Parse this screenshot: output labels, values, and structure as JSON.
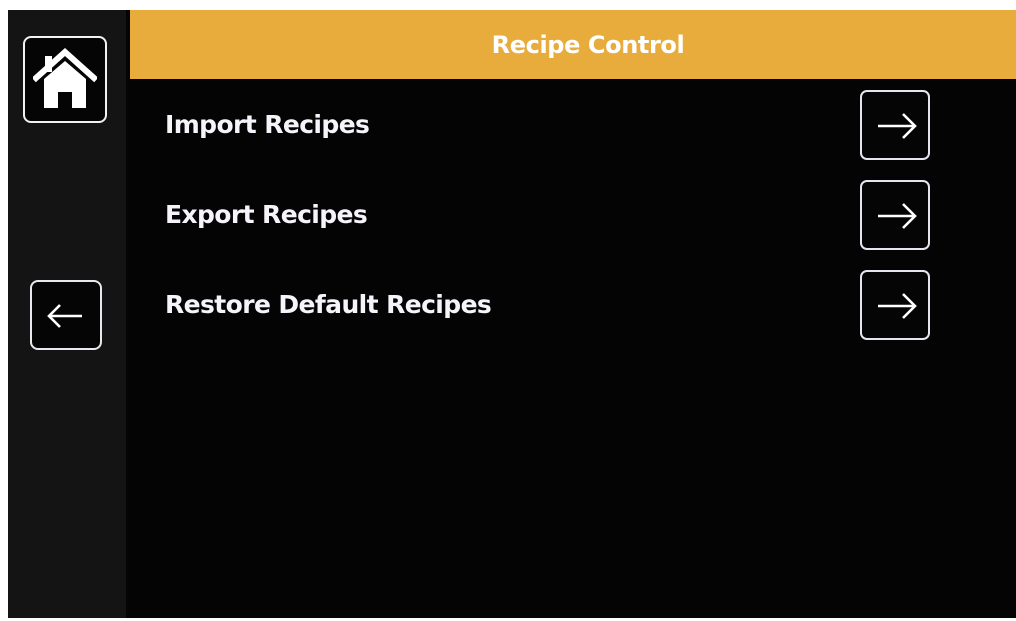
{
  "header": {
    "title": "Recipe Control",
    "accent_color": "#e7ac3c"
  },
  "sidebar": {
    "home_icon": "home-icon",
    "back_icon": "arrow-left-icon"
  },
  "menu": {
    "items": [
      {
        "label": "Import Recipes",
        "icon": "arrow-right-icon"
      },
      {
        "label": "Export Recipes",
        "icon": "arrow-right-icon"
      },
      {
        "label": "Restore Default Recipes",
        "icon": "arrow-right-icon"
      }
    ]
  }
}
